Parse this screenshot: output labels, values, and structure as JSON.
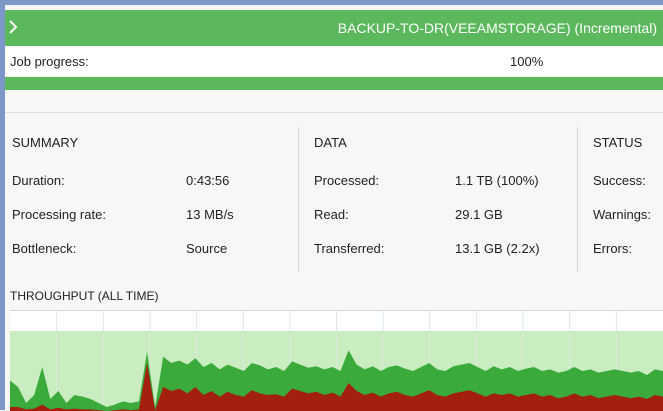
{
  "window": {
    "title": "BACKUP-TO-DR(VEEAMSTORAGE) (Incremental)"
  },
  "progress": {
    "label": "Job progress:",
    "value_text": "100%",
    "fraction": 1.0
  },
  "summary": {
    "title": "SUMMARY",
    "rows": [
      {
        "label": "Duration:",
        "value": "0:43:56"
      },
      {
        "label": "Processing rate:",
        "value": "13 MB/s"
      },
      {
        "label": "Bottleneck:",
        "value": "Source"
      }
    ]
  },
  "data_section": {
    "title": "DATA",
    "rows": [
      {
        "label": "Processed:",
        "value": "1.1 TB (100%)"
      },
      {
        "label": "Read:",
        "value": "29.1 GB"
      },
      {
        "label": "Transferred:",
        "value": "13.1 GB (2.2x)"
      }
    ]
  },
  "status": {
    "title": "STATUS",
    "rows": [
      {
        "label": "Success:"
      },
      {
        "label": "Warnings:"
      },
      {
        "label": "Errors:"
      }
    ]
  },
  "throughput": {
    "title": "THROUGHPUT (ALL TIME)"
  },
  "colors": {
    "accent": "#5cb85c",
    "chart_bg": "#c9ecc0",
    "read_series": "#3aab3a",
    "transfer_series": "#a31f0f"
  },
  "chart_data": {
    "type": "area",
    "series": [
      {
        "values": [
          0.38,
          0.3,
          0.1,
          0.2,
          0.55,
          0.15,
          0.25,
          0.1,
          0.2,
          0.18,
          0.15,
          0.1,
          0.05,
          0.08,
          0.12,
          0.1,
          0.12,
          0.74,
          0.05,
          0.68,
          0.6,
          0.63,
          0.58,
          0.66,
          0.55,
          0.6,
          0.52,
          0.58,
          0.54,
          0.5,
          0.6,
          0.57,
          0.52,
          0.55,
          0.5,
          0.62,
          0.58,
          0.54,
          0.56,
          0.52,
          0.55,
          0.5,
          0.76,
          0.58,
          0.52,
          0.56,
          0.5,
          0.55,
          0.57,
          0.53,
          0.5,
          0.55,
          0.6,
          0.52,
          0.5,
          0.56,
          0.58,
          0.6,
          0.55,
          0.5,
          0.56,
          0.52,
          0.55,
          0.5,
          0.53,
          0.55,
          0.5,
          0.52,
          0.48,
          0.5,
          0.55,
          0.5,
          0.52,
          0.48,
          0.5,
          0.52,
          0.5,
          0.48,
          0.5,
          0.45,
          0.52,
          0.5
        ]
      },
      {
        "values": [
          0.05,
          0.05,
          0.02,
          0.03,
          0.08,
          0.02,
          0.04,
          0.02,
          0.03,
          0.02,
          0.02,
          0.01,
          0.0,
          0.01,
          0.02,
          0.01,
          0.02,
          0.6,
          0.01,
          0.3,
          0.25,
          0.28,
          0.22,
          0.3,
          0.2,
          0.25,
          0.18,
          0.24,
          0.2,
          0.18,
          0.26,
          0.22,
          0.2,
          0.21,
          0.18,
          0.28,
          0.25,
          0.22,
          0.24,
          0.2,
          0.23,
          0.18,
          0.35,
          0.25,
          0.2,
          0.23,
          0.18,
          0.22,
          0.24,
          0.2,
          0.18,
          0.22,
          0.26,
          0.2,
          0.18,
          0.22,
          0.24,
          0.26,
          0.22,
          0.18,
          0.22,
          0.2,
          0.22,
          0.18,
          0.2,
          0.22,
          0.18,
          0.2,
          0.16,
          0.18,
          0.22,
          0.18,
          0.2,
          0.16,
          0.18,
          0.2,
          0.18,
          0.16,
          0.18,
          0.15,
          0.2,
          0.18
        ]
      }
    ],
    "ylim": [
      0,
      1
    ],
    "grid": true
  }
}
